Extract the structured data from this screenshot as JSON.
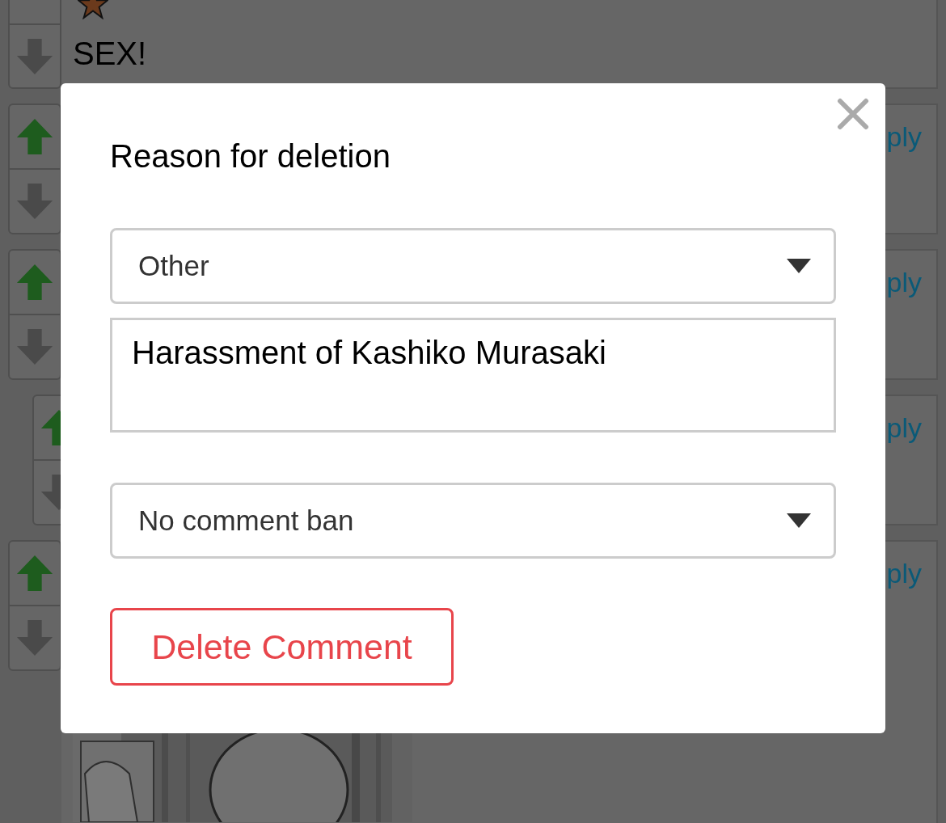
{
  "comments": [
    {
      "kind": "text",
      "text": "SEX!",
      "indented": false
    },
    {
      "kind": "reply",
      "link": "ply",
      "indented": false
    },
    {
      "kind": "reply",
      "link": "ply",
      "indented": false
    },
    {
      "kind": "reply",
      "link": "ply",
      "indented": true
    },
    {
      "link": "ply",
      "indented": false
    }
  ],
  "dialog": {
    "title": "Reason for deletion",
    "reason_select": {
      "value": "Other"
    },
    "reason_text": {
      "value": "Harassment of Kashiko Murasaki"
    },
    "ban_select": {
      "value": "No comment ban"
    },
    "delete_button": "Delete Comment"
  }
}
